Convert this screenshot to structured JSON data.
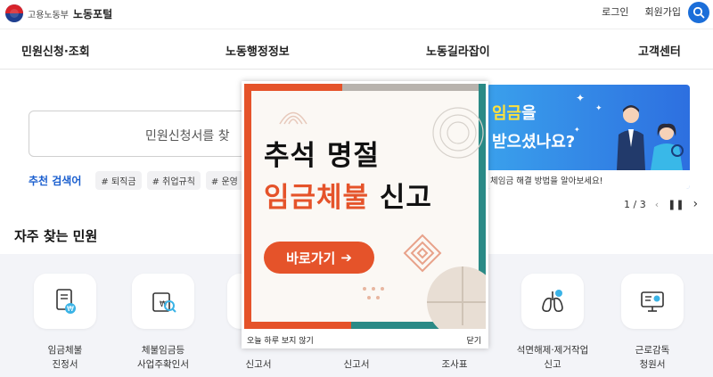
{
  "header": {
    "org": "고용노동부",
    "title": "노동포털",
    "login": "로그인",
    "signup": "회원가입"
  },
  "nav": [
    "민원신청·조회",
    "노동행정정보",
    "노동길라잡이",
    "고객센터"
  ],
  "search": {
    "placeholder": "민원신청서를 찾"
  },
  "recommend": {
    "label": "추천 검색어",
    "tags": [
      "# 퇴직금",
      "# 취업규칙",
      "# 운영"
    ]
  },
  "banner": {
    "line1_highlight": "임금",
    "line1_rest": "을",
    "line2": "받으셨나요?",
    "sub": "체임금 해결 방법을 알아보세요!",
    "pager": "1 / 3"
  },
  "section_title": "자주 찾는 민원",
  "services": [
    {
      "label": "임금체불\n진정서",
      "icon": "wage-document-icon"
    },
    {
      "label": "체불임금등\n사업주확인서",
      "icon": "confirmation-search-icon"
    },
    {
      "label": "\n신고서",
      "icon": "report-icon"
    },
    {
      "label": "\n신고서",
      "icon": "report-icon"
    },
    {
      "label": "\n조사표",
      "icon": "survey-icon"
    },
    {
      "label": "석면해제·제거작업\n신고",
      "icon": "lungs-icon"
    },
    {
      "label": "근로감독\n청원서",
      "icon": "monitor-icon"
    }
  ],
  "popup": {
    "line1": "추석 명절",
    "line2_red": "임금체불",
    "line2_black": " 신고",
    "button": "바로가기",
    "footer_left": "오늘 하루 보지 않기",
    "footer_right": "닫기"
  },
  "colors": {
    "accent": "#1b6ed9",
    "popup_accent": "#e5532a",
    "banner": "#2d6fe0"
  }
}
